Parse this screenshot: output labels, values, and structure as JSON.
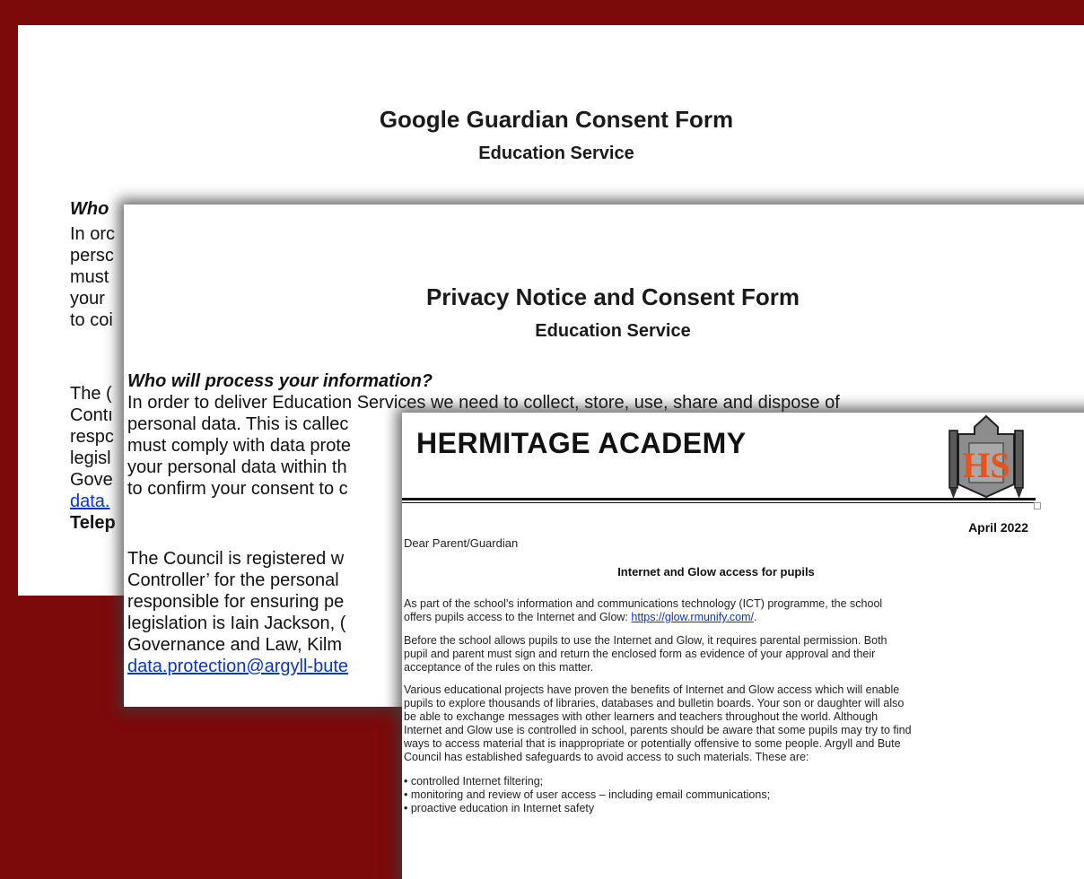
{
  "doc_google": {
    "title": "Google Guardian Consent Form",
    "subtitle": "Education Service",
    "lines": [
      "Who",
      "In orc",
      "persc",
      "must",
      "your",
      "to coi",
      "The (",
      "Contı",
      "respc",
      "legisl",
      "Gove",
      "data.",
      "Telep"
    ]
  },
  "doc_privacy": {
    "title": "Privacy Notice and Consent Form",
    "subtitle": "Education Service",
    "heading": "Who will process your information?",
    "lines": [
      "In order to deliver Education Services we need to collect, store, use, share and dispose of",
      "personal data. This is callec",
      "must comply with data prote",
      "your personal data within th",
      "to confirm your consent to c",
      "The Council is registered w",
      "Controller’ for the personal",
      "responsible for ensuring pe",
      "legislation is Iain Jackson, (",
      "Governance and Law, Kilm",
      "data.protection@argyll-bute"
    ]
  },
  "doc_hermitage": {
    "school_name": "HERMITAGE ACADEMY",
    "crest_letters": "HS",
    "date": "April 2022",
    "salutation": "Dear Parent/Guardian",
    "subject": "Internet and Glow access for pupils",
    "p1": [
      "As part of the school's information and communications technology (ICT) programme, the school",
      "offers pupils access to the Internet and Glow: "
    ],
    "p1_link": "https://glow.rmunify.com/",
    "p1_end": ".",
    "p2": [
      "Before the school allows pupils to use the Internet and Glow, it requires parental permission. Both",
      "pupil and parent must sign and return the enclosed form as evidence of your approval and their",
      "acceptance of the rules on this matter."
    ],
    "p3": [
      "Various educational projects have proven the benefits of Internet and Glow access which will enable",
      "pupils to explore thousands of libraries, databases and bulletin boards. Your son or daughter will also",
      "be able to exchange messages with other learners and teachers throughout the world. Although",
      "Internet and Glow use is controlled in school, parents should be aware that some pupils may try to find",
      "ways to access material that is inappropriate or potentially offensive to some people. Argyll and Bute",
      "Council has established safeguards to avoid access to such materials. These are:"
    ],
    "bullets": [
      "• controlled Internet filtering;",
      "• monitoring and review of user access – including email communications;",
      "• proactive education in Internet safety"
    ]
  },
  "colors": {
    "background": "#7d0a0a",
    "link": "#0a36c8",
    "crest_orange": "#e8521c"
  }
}
